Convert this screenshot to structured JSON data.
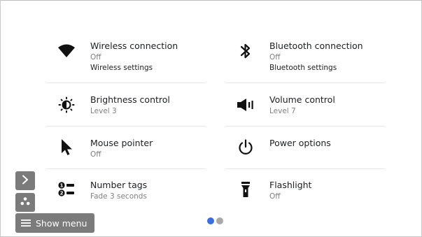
{
  "tiles": [
    {
      "title": "Wireless connection",
      "subtitle": "Off",
      "link": "Wireless settings",
      "icon": "wifi-icon"
    },
    {
      "title": "Bluetooth connection",
      "subtitle": "Off",
      "link": "Bluetooth settings",
      "icon": "bluetooth-icon"
    },
    {
      "title": "Brightness control",
      "subtitle": "Level 3",
      "icon": "brightness-icon"
    },
    {
      "title": "Volume control",
      "subtitle": "Level 7",
      "icon": "volume-icon"
    },
    {
      "title": "Mouse pointer",
      "subtitle": "Off",
      "icon": "mouse-pointer-icon"
    },
    {
      "title": "Power options",
      "subtitle": "",
      "icon": "power-icon"
    },
    {
      "title": "Number tags",
      "subtitle": "Fade 3 seconds",
      "icon": "number-tags-icon"
    },
    {
      "title": "Flashlight",
      "subtitle": "Off",
      "icon": "flashlight-icon"
    }
  ],
  "pagination": {
    "pages": 2,
    "current": 1,
    "active_color": "#3b6fe0",
    "inactive_color": "#a8a8a8"
  },
  "controls": {
    "show_menu_label": "Show menu",
    "expand_icon": "chevron-right-icon",
    "group_icon": "three-dots-icon",
    "menu_icon": "hamburger-icon",
    "button_color": "#7b7b7b"
  }
}
